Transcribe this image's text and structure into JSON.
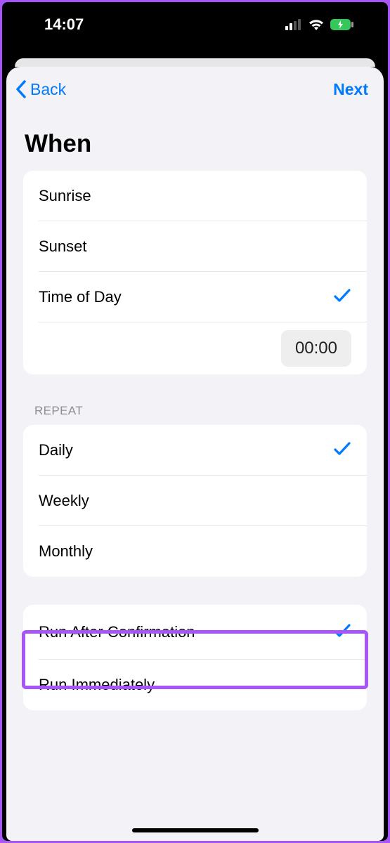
{
  "status": {
    "time": "14:07"
  },
  "nav": {
    "back": "Back",
    "next": "Next"
  },
  "title": "When",
  "when_group": {
    "sunrise": "Sunrise",
    "sunset": "Sunset",
    "time_of_day": "Time of Day",
    "time_value": "00:00"
  },
  "repeat": {
    "header": "REPEAT",
    "daily": "Daily",
    "weekly": "Weekly",
    "monthly": "Monthly"
  },
  "run": {
    "after_confirmation": "Run After Confirmation",
    "immediately": "Run Immediately"
  }
}
